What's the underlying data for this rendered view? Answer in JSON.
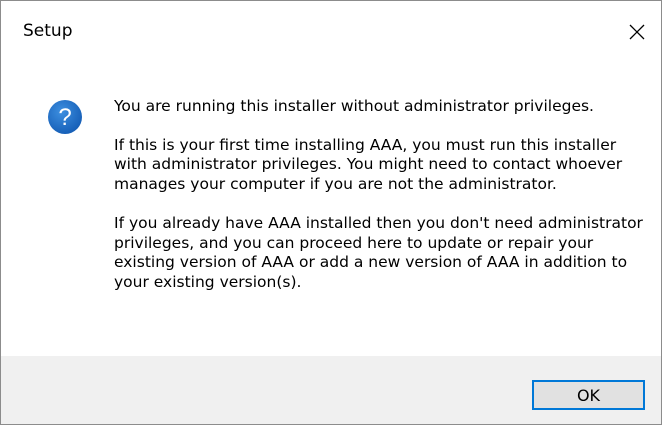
{
  "window": {
    "title": "Setup",
    "close_icon": "close-icon"
  },
  "message": {
    "icon": "question-icon",
    "icon_color": "#1f6fc5",
    "line1": "You are running this installer without administrator privileges.",
    "para2": "If this is your first time installing AAA, you must run this installer with administrator privileges. You might need to contact whoever manages your computer if you are not the administrator.",
    "para3": "If you already have AAA installed then you don't need administrator privileges, and you can proceed here to update or repair your existing version of AAA or add a new version of AAA in addition to your existing version(s)."
  },
  "footer": {
    "ok_label": "OK",
    "accent_color": "#0078d7"
  }
}
